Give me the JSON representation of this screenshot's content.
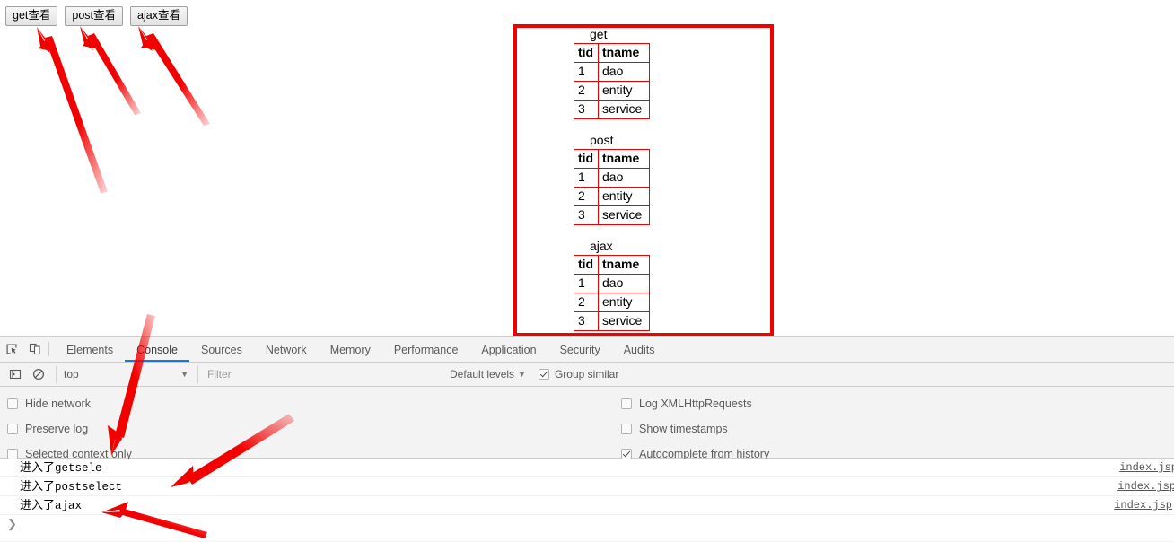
{
  "page": {
    "buttons": [
      {
        "label": "get查看"
      },
      {
        "label": "post查看"
      },
      {
        "label": "ajax查看"
      }
    ],
    "result_tables": [
      {
        "caption": "get",
        "headers": [
          "tid",
          "tname"
        ],
        "rows": [
          [
            "1",
            "dao"
          ],
          [
            "2",
            "entity"
          ],
          [
            "3",
            "service"
          ]
        ]
      },
      {
        "caption": "post",
        "headers": [
          "tid",
          "tname"
        ],
        "rows": [
          [
            "1",
            "dao"
          ],
          [
            "2",
            "entity"
          ],
          [
            "3",
            "service"
          ]
        ]
      },
      {
        "caption": "ajax",
        "headers": [
          "tid",
          "tname"
        ],
        "rows": [
          [
            "1",
            "dao"
          ],
          [
            "2",
            "entity"
          ],
          [
            "3",
            "service"
          ]
        ]
      }
    ],
    "annotation_color": "#f20000"
  },
  "devtools": {
    "tabs": [
      {
        "label": "Elements",
        "active": false
      },
      {
        "label": "Console",
        "active": true
      },
      {
        "label": "Sources",
        "active": false
      },
      {
        "label": "Network",
        "active": false
      },
      {
        "label": "Memory",
        "active": false
      },
      {
        "label": "Performance",
        "active": false
      },
      {
        "label": "Application",
        "active": false
      },
      {
        "label": "Security",
        "active": false
      },
      {
        "label": "Audits",
        "active": false
      }
    ],
    "icons": {
      "inspect": "inspect-element-icon",
      "device": "device-toolbar-icon",
      "sidebar": "console-sidebar-icon",
      "clear": "clear-console-icon"
    },
    "toolbar": {
      "context": "top",
      "filter_placeholder": "Filter",
      "filter_value": "",
      "levels": "Default levels",
      "group_similar": {
        "label": "Group similar",
        "checked": true
      }
    },
    "settings": {
      "left": [
        {
          "label": "Hide network",
          "checked": false
        },
        {
          "label": "Preserve log",
          "checked": false
        },
        {
          "label": "Selected context only",
          "checked": false
        }
      ],
      "right": [
        {
          "label": "Log XMLHttpRequests",
          "checked": false
        },
        {
          "label": "Show timestamps",
          "checked": false
        },
        {
          "label": "Autocomplete from history",
          "checked": true
        }
      ]
    },
    "console_messages": [
      {
        "cjk": "进入了",
        "mono": "getsele",
        "source": "index.jsp"
      },
      {
        "cjk": "进入了",
        "mono": "postselect",
        "source": "index.jsp"
      },
      {
        "cjk": "进入了",
        "mono": "ajax",
        "source": "index.jsp"
      }
    ],
    "prompt": "❯",
    "active_tab_underline_color": "#1a73e8"
  }
}
